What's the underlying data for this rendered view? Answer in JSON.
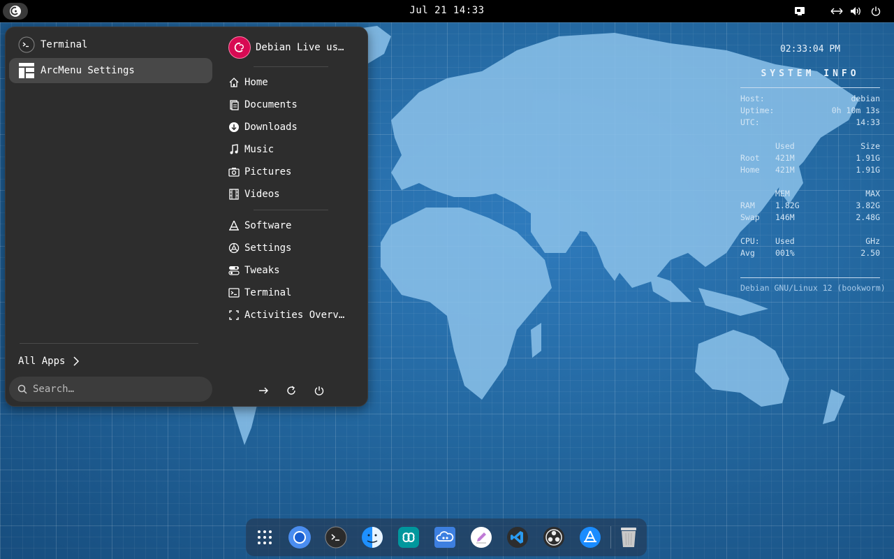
{
  "topbar": {
    "clock": "Jul 21  14:33",
    "icons": [
      "debian-logo-icon",
      "screen-share-icon",
      "network-icon",
      "volume-icon",
      "power-icon"
    ]
  },
  "arcmenu": {
    "apps": [
      {
        "label": "Terminal",
        "icon": "terminal-icon"
      },
      {
        "label": "ArcMenu Settings",
        "icon": "arcmenu-settings-icon",
        "selected": true
      }
    ],
    "all_apps_label": "All Apps",
    "search_placeholder": "Search…",
    "user": {
      "name": "Debian Live us…"
    },
    "places": [
      {
        "label": "Home",
        "icon": "home-icon"
      },
      {
        "label": "Documents",
        "icon": "documents-icon"
      },
      {
        "label": "Downloads",
        "icon": "downloads-icon"
      },
      {
        "label": "Music",
        "icon": "music-icon"
      },
      {
        "label": "Pictures",
        "icon": "camera-icon"
      },
      {
        "label": "Videos",
        "icon": "film-icon"
      }
    ],
    "shortcuts": [
      {
        "label": "Software",
        "icon": "software-icon"
      },
      {
        "label": "Settings",
        "icon": "settings-icon"
      },
      {
        "label": "Tweaks",
        "icon": "tweaks-icon"
      },
      {
        "label": "Terminal",
        "icon": "terminal-icon"
      },
      {
        "label": "Activities Overv…",
        "icon": "activities-icon"
      }
    ],
    "power_buttons": [
      "logout-icon",
      "restart-icon",
      "power-icon"
    ]
  },
  "conky": {
    "time": "02:33:04 PM",
    "title": "SYSTEM  INFO",
    "host_label": "Host:",
    "host_value": "debian",
    "uptime_label": "Uptime:",
    "uptime_value": "0h 10m 13s",
    "utc_label": "UTC:",
    "utc_value": "14:33",
    "disk_header_used": "Used",
    "disk_header_size": "Size",
    "root_label": "Root",
    "root_used": "421M",
    "root_size": "1.91G",
    "home_label": "Home",
    "home_used": "421M",
    "home_size": "1.91G",
    "mem_header": "MEM",
    "max_header": "MAX",
    "ram_label": "RAM",
    "ram_used": "1.82G",
    "ram_max": "3.82G",
    "swap_label": "Swap",
    "swap_used": "146M",
    "swap_max": "2.48G",
    "cpu_label": "CPU:",
    "cpu_used_header": "Used",
    "cpu_ghz_header": "GHz",
    "avg_label": "Avg",
    "avg_used": "001%",
    "avg_ghz": "2.50",
    "footer": "Debian GNU/Linux 12 (bookworm)"
  },
  "dock": {
    "items": [
      {
        "name": "show-apps",
        "icon": "app-grid-icon"
      },
      {
        "name": "chromium",
        "icon": "chromium-icon"
      },
      {
        "name": "terminal",
        "icon": "terminal-icon"
      },
      {
        "name": "files",
        "icon": "finder-icon"
      },
      {
        "name": "arduino",
        "icon": "arduino-icon"
      },
      {
        "name": "cloud-app",
        "icon": "cloud-icon"
      },
      {
        "name": "text-editor",
        "icon": "pencil-icon"
      },
      {
        "name": "vscode",
        "icon": "vscode-icon"
      },
      {
        "name": "obs-studio",
        "icon": "obs-icon"
      },
      {
        "name": "software-store",
        "icon": "app-store-icon"
      },
      {
        "name": "trash",
        "icon": "trash-icon"
      }
    ]
  },
  "colors": {
    "menu_bg": "#2d2d2d",
    "selected_bg": "#484848",
    "debian_red": "#d70a53",
    "wallpaper": "#23679f",
    "map": "#7fb6e0"
  }
}
